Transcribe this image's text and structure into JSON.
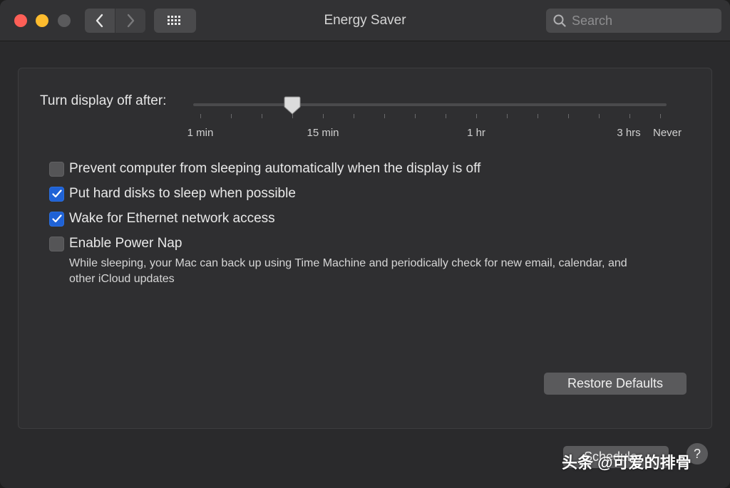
{
  "window": {
    "title": "Energy Saver"
  },
  "toolbar": {
    "search_placeholder": "Search"
  },
  "slider": {
    "label": "Turn display off after:",
    "tick_labels": [
      "1 min",
      "15 min",
      "1 hr",
      "3 hrs",
      "Never"
    ],
    "selected_tick_index": 6,
    "tick_count": 16
  },
  "options": [
    {
      "label": "Prevent computer from sleeping automatically when the display is off",
      "checked": false
    },
    {
      "label": "Put hard disks to sleep when possible",
      "checked": true
    },
    {
      "label": "Wake for Ethernet network access",
      "checked": true
    },
    {
      "label": "Enable Power Nap",
      "checked": false
    }
  ],
  "power_nap_description": "While sleeping, your Mac can back up using Time Machine and periodically check for new email, calendar, and other iCloud updates",
  "buttons": {
    "restore_defaults": "Restore Defaults",
    "schedule": "Schedule...",
    "help": "?"
  },
  "watermark": "头条 @可爱的排骨",
  "colors": {
    "accent": "#1f62d6",
    "close": "#fe5f57",
    "minimize": "#febc2e"
  }
}
